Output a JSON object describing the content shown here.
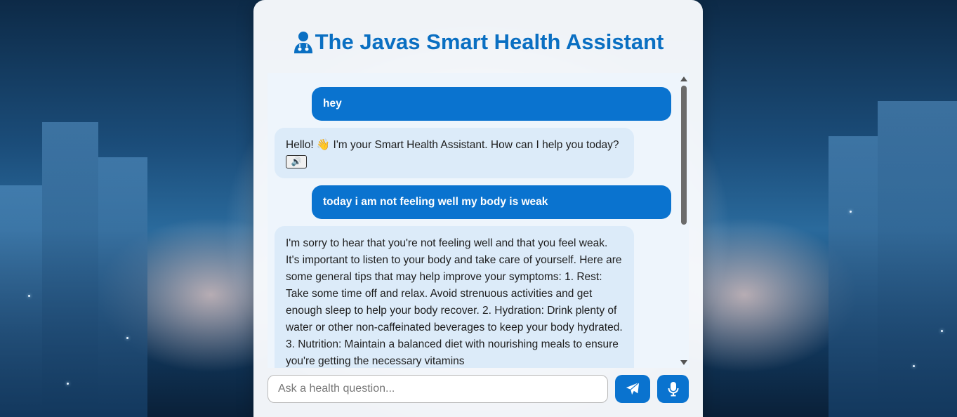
{
  "header": {
    "title": "The Javas Smart Health Assistant",
    "icon": "doctor-icon"
  },
  "chat": {
    "messages": [
      {
        "role": "user",
        "text": "hey"
      },
      {
        "role": "assistant",
        "text": "Hello! 👋 I'm your Smart Health Assistant. How can I help you today?",
        "speak_icon": "speaker-icon",
        "speak_glyph": "🔊"
      },
      {
        "role": "user",
        "text": "today i am not feeling well my body is weak"
      },
      {
        "role": "assistant",
        "text": "I'm sorry to hear that you're not feeling well and that you feel weak. It's important to listen to your body and take care of yourself. Here are some general tips that may help improve your symptoms: 1. Rest: Take some time off and relax. Avoid strenuous activities and get enough sleep to help your body recover. 2. Hydration: Drink plenty of water or other non-caffeinated beverages to keep your body hydrated. 3. Nutrition: Maintain a balanced diet with nourishing meals to ensure you're getting the necessary vitamins"
      }
    ]
  },
  "composer": {
    "placeholder": "Ask a health question...",
    "value": "",
    "send_icon": "paper-plane-icon",
    "mic_icon": "microphone-icon"
  },
  "colors": {
    "accent": "#0a73cf",
    "title": "#0a6fc2",
    "bot_bubble": "#dcebf9"
  }
}
